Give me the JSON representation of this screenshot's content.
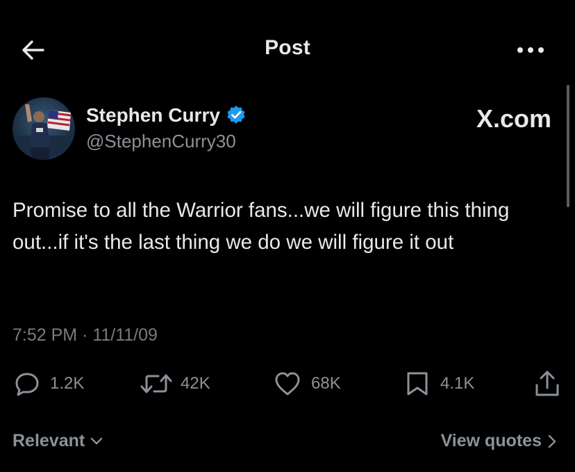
{
  "header": {
    "title": "Post",
    "back_icon": "arrow-left-icon",
    "more_icon": "more-horizontal-icon"
  },
  "author": {
    "name": "Stephen Curry",
    "handle": "@StephenCurry30",
    "verified": true,
    "verified_color": "#1d9bf0"
  },
  "source_label": "X.com",
  "tweet": {
    "text": "Promise to all the Warrior fans...we will figure this thing out...if it's the last thing we do we will figure it out",
    "timestamp": "7:52 PM · 11/11/09"
  },
  "actions": {
    "replies": "1.2K",
    "reposts": "42K",
    "likes": "68K",
    "bookmarks": "4.1K"
  },
  "footer": {
    "sort_label": "Relevant",
    "quotes_label": "View quotes"
  },
  "colors": {
    "background": "#000000",
    "text_primary": "#e7e9ea",
    "text_secondary": "#8b9299"
  }
}
